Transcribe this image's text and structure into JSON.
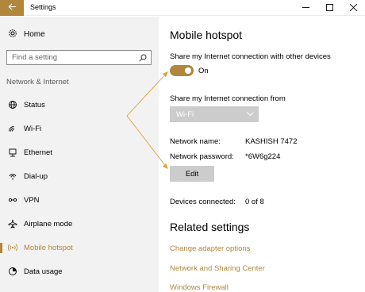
{
  "window": {
    "title": "Settings",
    "back_icon": "arrow-left-icon",
    "controls": [
      "minimize-icon",
      "maximize-icon",
      "close-icon"
    ],
    "accent_color": "#b0873d"
  },
  "sidebar": {
    "home_label": "Home",
    "search_placeholder": "Find a setting",
    "section_label": "Network & Internet",
    "items": [
      {
        "label": "Status",
        "icon": "globe-icon"
      },
      {
        "label": "Wi-Fi",
        "icon": "wifi-icon"
      },
      {
        "label": "Ethernet",
        "icon": "ethernet-icon"
      },
      {
        "label": "Dial-up",
        "icon": "dialup-icon"
      },
      {
        "label": "VPN",
        "icon": "vpn-icon"
      },
      {
        "label": "Airplane mode",
        "icon": "airplane-icon"
      },
      {
        "label": "Mobile hotspot",
        "icon": "hotspot-icon",
        "active": true
      },
      {
        "label": "Data usage",
        "icon": "data-usage-icon"
      }
    ]
  },
  "main": {
    "title": "Mobile hotspot",
    "share_label": "Share my Internet connection with other devices",
    "toggle_state": "On",
    "share_from_label": "Share my Internet connection from",
    "share_from_value": "Wi-Fi",
    "network_name_label": "Network name:",
    "network_name_value": "KASHISH 7472",
    "network_password_label": "Network password:",
    "network_password_value": "*6W6g224",
    "edit_label": "Edit",
    "devices_label": "Devices connected:",
    "devices_value": "0 of 8",
    "related_title": "Related settings",
    "related_links": [
      "Change adapter options",
      "Network and Sharing Center",
      "Windows Firewall"
    ]
  }
}
